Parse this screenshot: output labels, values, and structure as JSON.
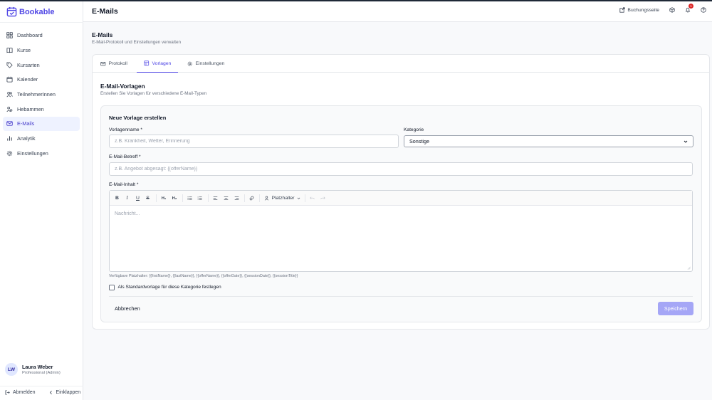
{
  "app": {
    "name": "Bookable"
  },
  "sidebar": {
    "items": [
      {
        "label": "Dashboard",
        "icon": "dashboard-icon"
      },
      {
        "label": "Kurse",
        "icon": "book-icon"
      },
      {
        "label": "Kursarten",
        "icon": "tag-icon"
      },
      {
        "label": "Kalender",
        "icon": "calendar-icon"
      },
      {
        "label": "TeilnehmerInnen",
        "icon": "users-icon"
      },
      {
        "label": "Hebammen",
        "icon": "user-group-icon"
      },
      {
        "label": "E-Mails",
        "icon": "mail-icon",
        "active": true
      },
      {
        "label": "Analytik",
        "icon": "chart-icon"
      },
      {
        "label": "Einstellungen",
        "icon": "gear-icon"
      }
    ],
    "user": {
      "initials": "LW",
      "name": "Laura Weber",
      "role": "Professional (Admin)"
    },
    "logout_label": "Abmelden",
    "collapse_label": "Einklappen"
  },
  "header": {
    "title": "E-Mails",
    "booking_link_label": "Buchungsseite",
    "notification_count": "1"
  },
  "page": {
    "title": "E-Mails",
    "subtitle": "E-Mail-Protokoll und Einstellungen verwalten"
  },
  "tabs": [
    {
      "label": "Protokoll",
      "icon": "mail-icon"
    },
    {
      "label": "Vorlagen",
      "icon": "template-icon",
      "active": true
    },
    {
      "label": "Einstellungen",
      "icon": "gear-icon"
    }
  ],
  "section": {
    "title": "E-Mail-Vorlagen",
    "subtitle": "Erstellen Sie Vorlagen für verschiedene E-Mail-Typen"
  },
  "form": {
    "title": "Neue Vorlage erstellen",
    "name_label": "Vorlagenname *",
    "name_placeholder": "z.B. Krankheit, Wetter, Erinnerung",
    "category_label": "Kategorie",
    "category_value": "Sonstige",
    "subject_label": "E-Mail-Betreff *",
    "subject_placeholder": "z.B. Angebot abgesagt: {{offerName}}",
    "content_label": "E-Mail-Inhalt *",
    "content_placeholder": "Nachricht...",
    "toolbar": {
      "bold": "B",
      "italic": "I",
      "underline": "U",
      "strike": "S",
      "h1": "H₁",
      "h2": "H₂",
      "placeholder_menu": "Platzhalter"
    },
    "placeholder_hint": "Verfügbare Platzhalter: {{firstName}}, {{lastName}}, {{offerName}}, {{offerDate}}, {{sessionDate}}, {{sessionTitle}}",
    "default_checkbox_label": "Als Standardvorlage für diese Kategorie festlegen",
    "cancel_label": "Abbrechen",
    "save_label": "Speichern"
  },
  "colors": {
    "accent": "#4f46e5",
    "save_button": "#a5a6f6",
    "badge": "#dc2626"
  }
}
